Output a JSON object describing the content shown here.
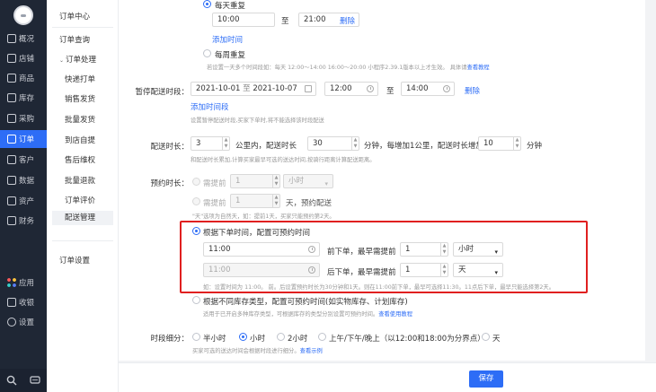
{
  "nav": {
    "items": [
      {
        "label": "概况",
        "icon": "dashboard-icon"
      },
      {
        "label": "店铺",
        "icon": "store-icon"
      },
      {
        "label": "商品",
        "icon": "goods-icon"
      },
      {
        "label": "库存",
        "icon": "inventory-icon"
      },
      {
        "label": "采购",
        "icon": "purchase-icon"
      },
      {
        "label": "订单",
        "icon": "order-icon"
      },
      {
        "label": "客户",
        "icon": "customer-icon"
      },
      {
        "label": "数据",
        "icon": "data-icon"
      },
      {
        "label": "资产",
        "icon": "assets-icon"
      },
      {
        "label": "财务",
        "icon": "finance-icon"
      }
    ],
    "bottom_items": [
      {
        "label": "应用",
        "icon": "apps-icon"
      },
      {
        "label": "收银",
        "icon": "cashier-icon"
      },
      {
        "label": "设置",
        "icon": "settings-icon"
      }
    ],
    "footer_icons": [
      "search-icon",
      "chat-icon"
    ]
  },
  "menu": {
    "title": "订单中心",
    "order_query": "订单查询",
    "order_process": "订单处理",
    "subs": [
      "快递打单",
      "销售发货",
      "批量发货",
      "到店自提",
      "售后维权",
      "批量退款",
      "订单评价",
      "配送管理"
    ],
    "order_settings": "订单设置"
  },
  "daily": {
    "option_label": "每天重复",
    "start": "10:00",
    "to": "至",
    "end": "21:00",
    "delete": "删除",
    "add_time": "添加时间",
    "weekly_label": "每周重复",
    "hint": "若设置一天多个时间段如：每天 12:00～14:00 16:00～20:00 小程序2.39.1版本以上才生效。 具体请",
    "hint_link": "查看教程"
  },
  "pause": {
    "label": "暂停配送时段：",
    "date_start": "2021-10-01",
    "date_to": "至",
    "date_end": "2021-10-07",
    "time_start": "12:00",
    "time_to": "至",
    "time_end": "14:00",
    "delete": "删除",
    "add": "添加时间段",
    "hint": "设置暂停配送时段,买家下单时,将不能选择该时段配送"
  },
  "duration": {
    "label": "配送时长：",
    "km": "3",
    "km_text": "公里内，配送时长",
    "minutes": "30",
    "per_text": "分钟，每增加1公里，配送时长增加",
    "inc": "10",
    "min_text": "分钟",
    "hint": "和配送时长累加,计算买家最早可选的送达时间,按骑行距离计算配送距离。"
  },
  "reserve": {
    "label": "预约时长：",
    "need_ahead_1": "需提前",
    "val1": "1",
    "unit1": "小时",
    "need_ahead_2": "需提前",
    "val2": "1",
    "days_text": "天，预约配送",
    "hint": "\"天\"选项为自然天，如：提前1天，买家只能预约第2天。"
  },
  "by_order": {
    "option_label": "根据下单时间，配置可预约时间",
    "time1": "11:00",
    "before_text1": "前下单，最早需提前",
    "val1": "1",
    "unit1": "小时",
    "time2": "11:00",
    "after_text2": "后下单，最早需提前",
    "val2": "1",
    "unit2": "天",
    "hint": "如：设置时间为 11:00。 前。后设置预约时长为30分钟和1天。则在11:00前下单，最早可选择11:30。11点后下单，最早只能选择第2天。"
  },
  "by_stock": {
    "option_label": "根据不同库存类型，配置可预约时间(如实物库存、计划库存)",
    "hint": "适用于已开启多种库存类型，可根据库存的类型分别设置可预约时间。",
    "hint_link": "查看使用教程"
  },
  "segment": {
    "label": "时段细分：",
    "options": [
      "半小时",
      "小时",
      "2小时",
      "上午/下午/晚上（以12:00和18:00为分界点）",
      "天"
    ],
    "hint": "买家可选的送达时间会根据时段进行细分。",
    "hint_link": "查看示例"
  },
  "footer": {
    "save": "保存"
  }
}
